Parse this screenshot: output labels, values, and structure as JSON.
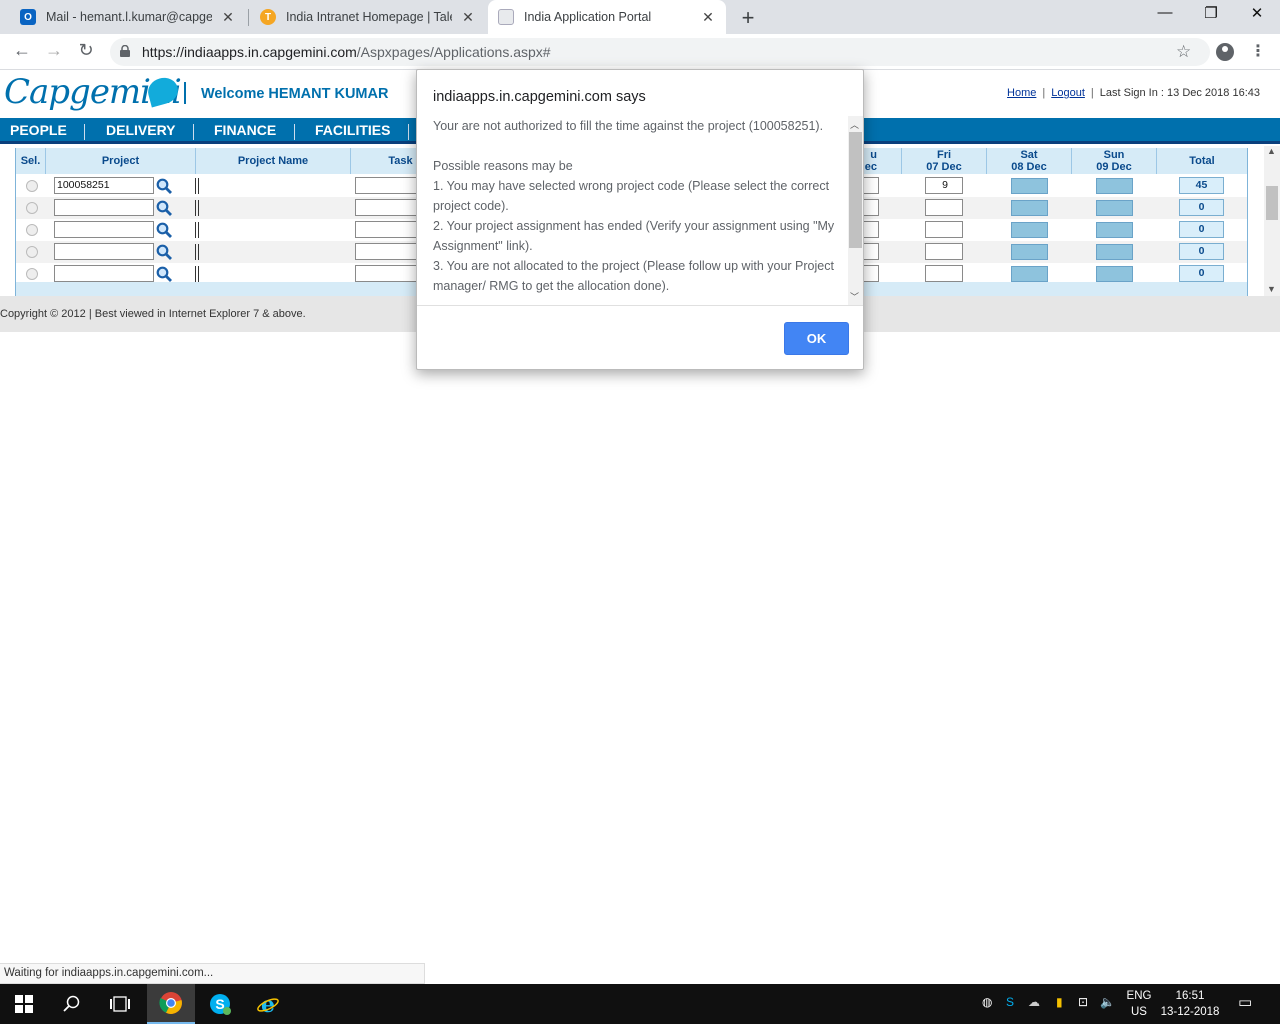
{
  "browser": {
    "tabs": [
      {
        "title": "Mail - hemant.l.kumar@capgemi",
        "icon": "outlook-icon"
      },
      {
        "title": "India Intranet Homepage | Talent",
        "icon": "intranet-icon"
      },
      {
        "title": "India Application Portal",
        "icon": "page-icon",
        "active": true
      }
    ],
    "url_host": "https://indiaapps.in.capgemini.com",
    "url_path": "/Aspxpages/Applications.aspx#",
    "status_text": "Waiting for indiaapps.in.capgemini.com..."
  },
  "header": {
    "logo_text": "Capgemini",
    "welcome": "Welcome HEMANT KUMAR",
    "home_link": "Home",
    "logout_link": "Logout",
    "last_sign_in": "Last Sign In : 13 Dec 2018 16:43"
  },
  "menu": [
    "PEOPLE",
    "DELIVERY",
    "FINANCE",
    "FACILITIES"
  ],
  "grid": {
    "headers": {
      "sel": "Sel.",
      "project": "Project",
      "project_name": "Project Name",
      "task": "Task",
      "thu_partial": "u",
      "thu_partial_2": "ec",
      "fri_day": "Fri",
      "fri_date": "07 Dec",
      "sat_day": "Sat",
      "sat_date": "08 Dec",
      "sun_day": "Sun",
      "sun_date": "09 Dec",
      "total": "Total"
    },
    "rows": [
      {
        "project": "100058251",
        "fri": "9",
        "total": "45"
      },
      {
        "project": "",
        "fri": "",
        "total": "0"
      },
      {
        "project": "",
        "fri": "",
        "total": "0"
      },
      {
        "project": "",
        "fri": "",
        "total": "0"
      },
      {
        "project": "",
        "fri": "",
        "total": "0"
      }
    ]
  },
  "footer": {
    "copyright": "Copyright © 2012 | Best viewed in Internet Explorer 7 & above."
  },
  "dialog": {
    "title": "indiaapps.in.capgemini.com says",
    "line1": "Your are not authorized to fill the time against the project (100058251).",
    "line2": "Possible reasons may be",
    "line3": "1. You may have selected wrong project code (Please select the correct project code).",
    "line4": "2. Your project assignment has ended (Verify your assignment using \"My Assignment\" link).",
    "line5": "3. You are not allocated to the project (Please follow up with your Project manager/ RMG to get the allocation done).",
    "ok_label": "OK"
  },
  "taskbar": {
    "lang_1": "ENG",
    "lang_2": "US",
    "time": "16:51",
    "date": "13-12-2018"
  },
  "colors": {
    "brand_blue": "#0070ad",
    "dialog_ok": "#4285f4"
  }
}
